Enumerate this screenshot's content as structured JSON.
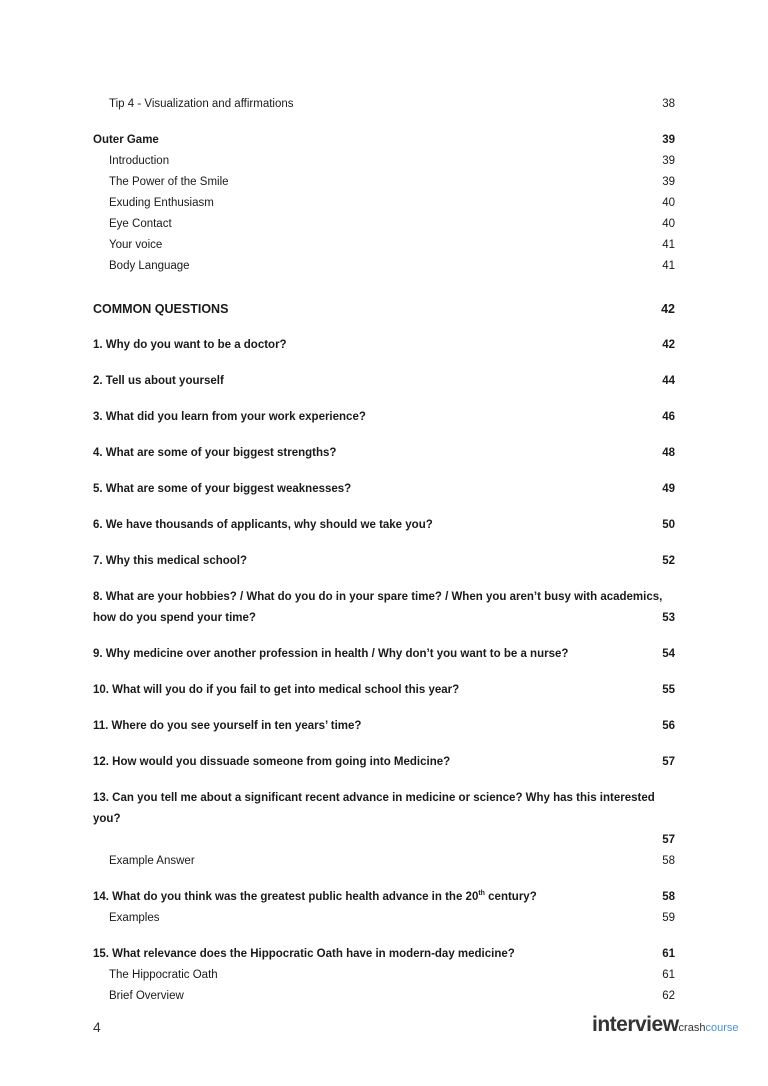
{
  "toc": {
    "tip4": {
      "label": "Tip 4 - Visualization and affirmations",
      "page": "38"
    },
    "outer_game": {
      "label": "Outer Game",
      "page": "39"
    },
    "outer_items": [
      {
        "label": "Introduction",
        "page": "39"
      },
      {
        "label": "The Power of the Smile",
        "page": "39"
      },
      {
        "label": "Exuding Enthusiasm",
        "page": "40"
      },
      {
        "label": "Eye Contact",
        "page": "40"
      },
      {
        "label": "Your voice",
        "page": "41"
      },
      {
        "label": "Body Language",
        "page": "41"
      }
    ],
    "common_questions": {
      "label": "COMMON QUESTIONS",
      "page": "42"
    },
    "questions": [
      {
        "label": "1. Why do you want to be a doctor?",
        "page": "42"
      },
      {
        "label": "2. Tell us about yourself",
        "page": "44"
      },
      {
        "label": "3. What did you learn from your work experience?",
        "page": "46"
      },
      {
        "label": "4. What are some of your biggest strengths?",
        "page": "48"
      },
      {
        "label": "5. What are some of your biggest weaknesses?",
        "page": "49"
      },
      {
        "label": "6. We have thousands of applicants, why should we take you?",
        "page": "50"
      },
      {
        "label": "7. Why this medical school?",
        "page": "52"
      },
      {
        "label_line1": "8. What are your hobbies? / What do you do in your spare time? / When you aren’t busy with academics,",
        "label_line2": "how do you spend your time?",
        "page": "53"
      },
      {
        "label": "9. Why medicine over another profession in health / Why don’t you want to be a nurse?",
        "page": "54"
      },
      {
        "label": "10. What will you do if you fail to get into medical school this year?",
        "page": "55"
      },
      {
        "label": "11. Where do you see yourself in ten years’ time?",
        "page": "56"
      },
      {
        "label": "12. How would you dissuade someone from going into Medicine?",
        "page": "57"
      },
      {
        "label": "13. Can you tell me about a significant recent advance in medicine or science? Why has this interested you?",
        "page": "57"
      },
      {
        "label": "Example Answer",
        "page": "58"
      },
      {
        "label_pre": "14. What do you think was the greatest public health advance in the 20",
        "label_sup": "th",
        "label_post": " century?",
        "page": "58"
      },
      {
        "label": "Examples",
        "page": "59"
      },
      {
        "label": "15. What relevance does the Hippocratic Oath have in modern-day medicine?",
        "page": "61"
      },
      {
        "label": "The Hippocratic Oath",
        "page": "61"
      },
      {
        "label": "Brief Overview",
        "page": "62"
      }
    ]
  },
  "footer": {
    "page_number": "4",
    "logo_main": "interview",
    "logo_crash": "crash",
    "logo_course": "course"
  }
}
